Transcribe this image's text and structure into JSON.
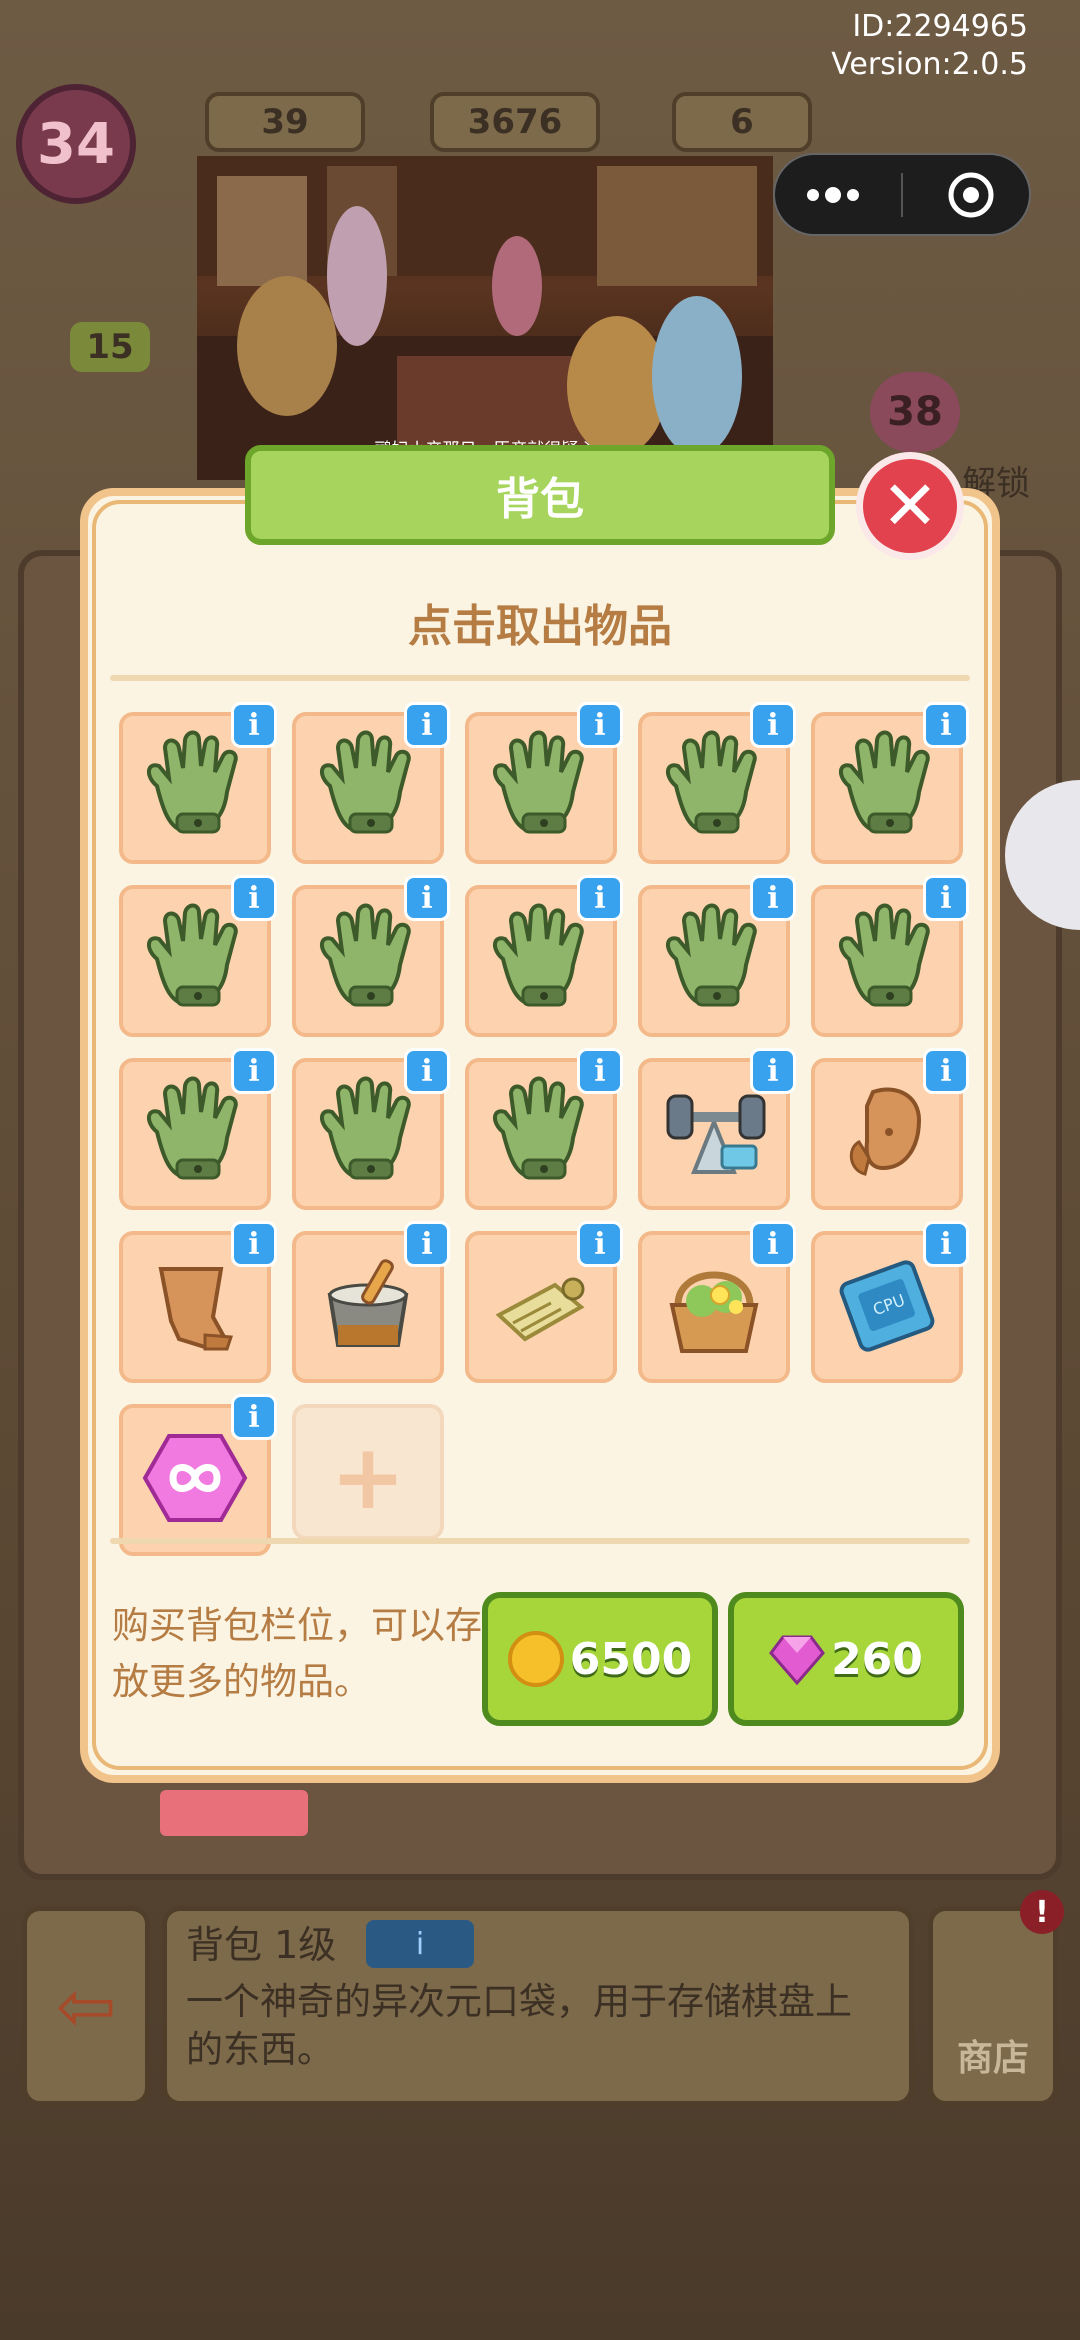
{
  "hud": {
    "version_id": "ID:2294965",
    "version": "Version:2.0.5",
    "level": "34",
    "energy": "39",
    "coins": "3676",
    "gems": "6",
    "star_level": "15",
    "heart_count": "38",
    "side_text": "解锁"
  },
  "video": {
    "subtitle": "鹂妃小产那日　臣妾就很疑心"
  },
  "dialog": {
    "ribbon_title": "背包",
    "title": "点击取出物品",
    "info_label": "i",
    "slots": [
      {
        "item": "glove"
      },
      {
        "item": "glove"
      },
      {
        "item": "glove"
      },
      {
        "item": "glove"
      },
      {
        "item": "glove"
      },
      {
        "item": "glove"
      },
      {
        "item": "glove"
      },
      {
        "item": "glove"
      },
      {
        "item": "glove"
      },
      {
        "item": "glove"
      },
      {
        "item": "glove"
      },
      {
        "item": "glove"
      },
      {
        "item": "glove"
      },
      {
        "item": "dumbbell-rack"
      },
      {
        "item": "clay-shard"
      },
      {
        "item": "broken-pot"
      },
      {
        "item": "mortar-pestle"
      },
      {
        "item": "scroll"
      },
      {
        "item": "flower-basket"
      },
      {
        "item": "cpu-chip"
      },
      {
        "item": "infinity-gem"
      }
    ],
    "add_slot_symbol": "+",
    "buy_text": "购买背包栏位，可以存放更多的物品。",
    "price_coins": "6500",
    "price_gems": "260"
  },
  "bottom": {
    "title": "背包 1级",
    "tag": "i",
    "description": "一个神奇的异次元口袋，用于存储棋盘上的东西。",
    "shop_label": "商店",
    "badge": "!"
  },
  "colors": {
    "accent_green": "#a7d63b",
    "info_blue": "#39a2ee",
    "close_red": "#e2424d",
    "title_brown": "#b57c44"
  }
}
